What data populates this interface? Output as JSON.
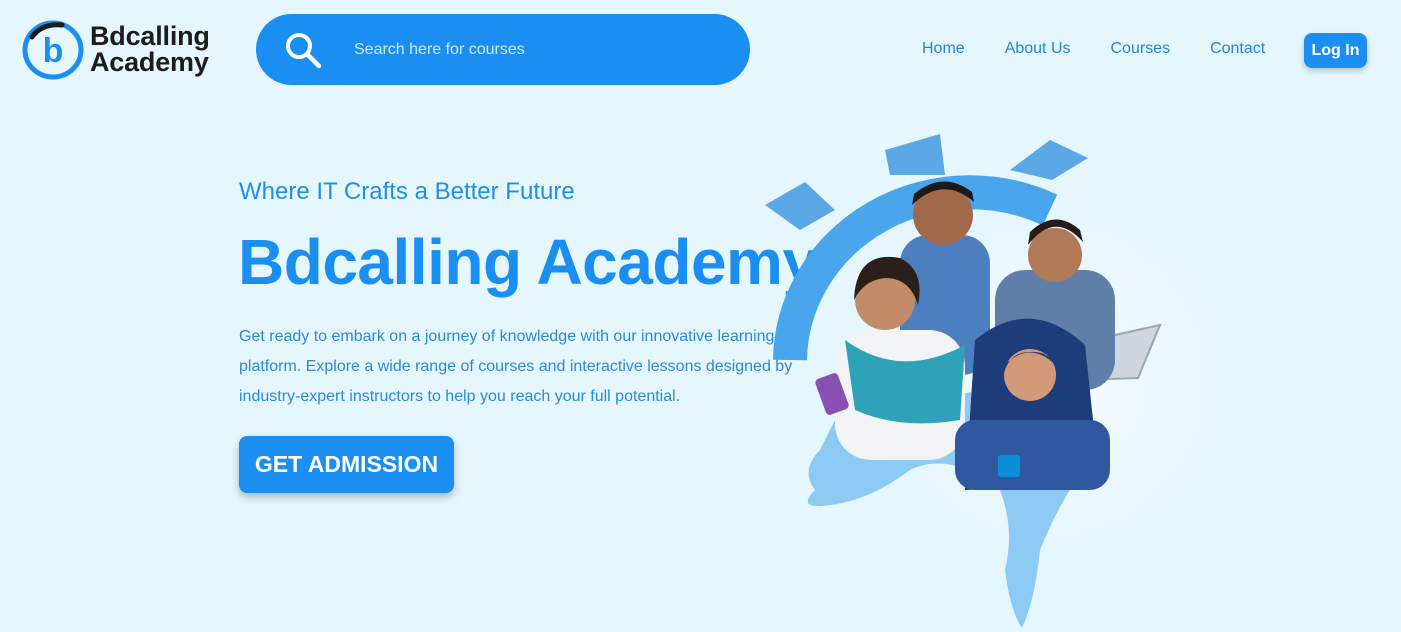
{
  "header": {
    "logo": {
      "line1": "Bdcalling",
      "line2": "Academy",
      "mark": "b"
    },
    "search": {
      "placeholder": "Search here for courses",
      "icon": "search-icon"
    },
    "nav": [
      {
        "label": "Home"
      },
      {
        "label": "About Us"
      },
      {
        "label": "Courses"
      },
      {
        "label": "Contact"
      }
    ],
    "login_label": "Log In"
  },
  "hero": {
    "tagline": "Where IT Crafts a Better Future",
    "title": "Bdcalling Academy",
    "description": "Get ready to embark on a journey of knowledge with our innovative learning platform. Explore a wide range of courses and interactive lessons designed by industry-expert instructors to help you reach your full potential.",
    "cta_label": "GET ADMISSION"
  },
  "colors": {
    "background": "#e5f6fd",
    "accent": "#1a8ff1",
    "nav_text": "#1f86d9",
    "logo_text": "#1c1c1c"
  }
}
